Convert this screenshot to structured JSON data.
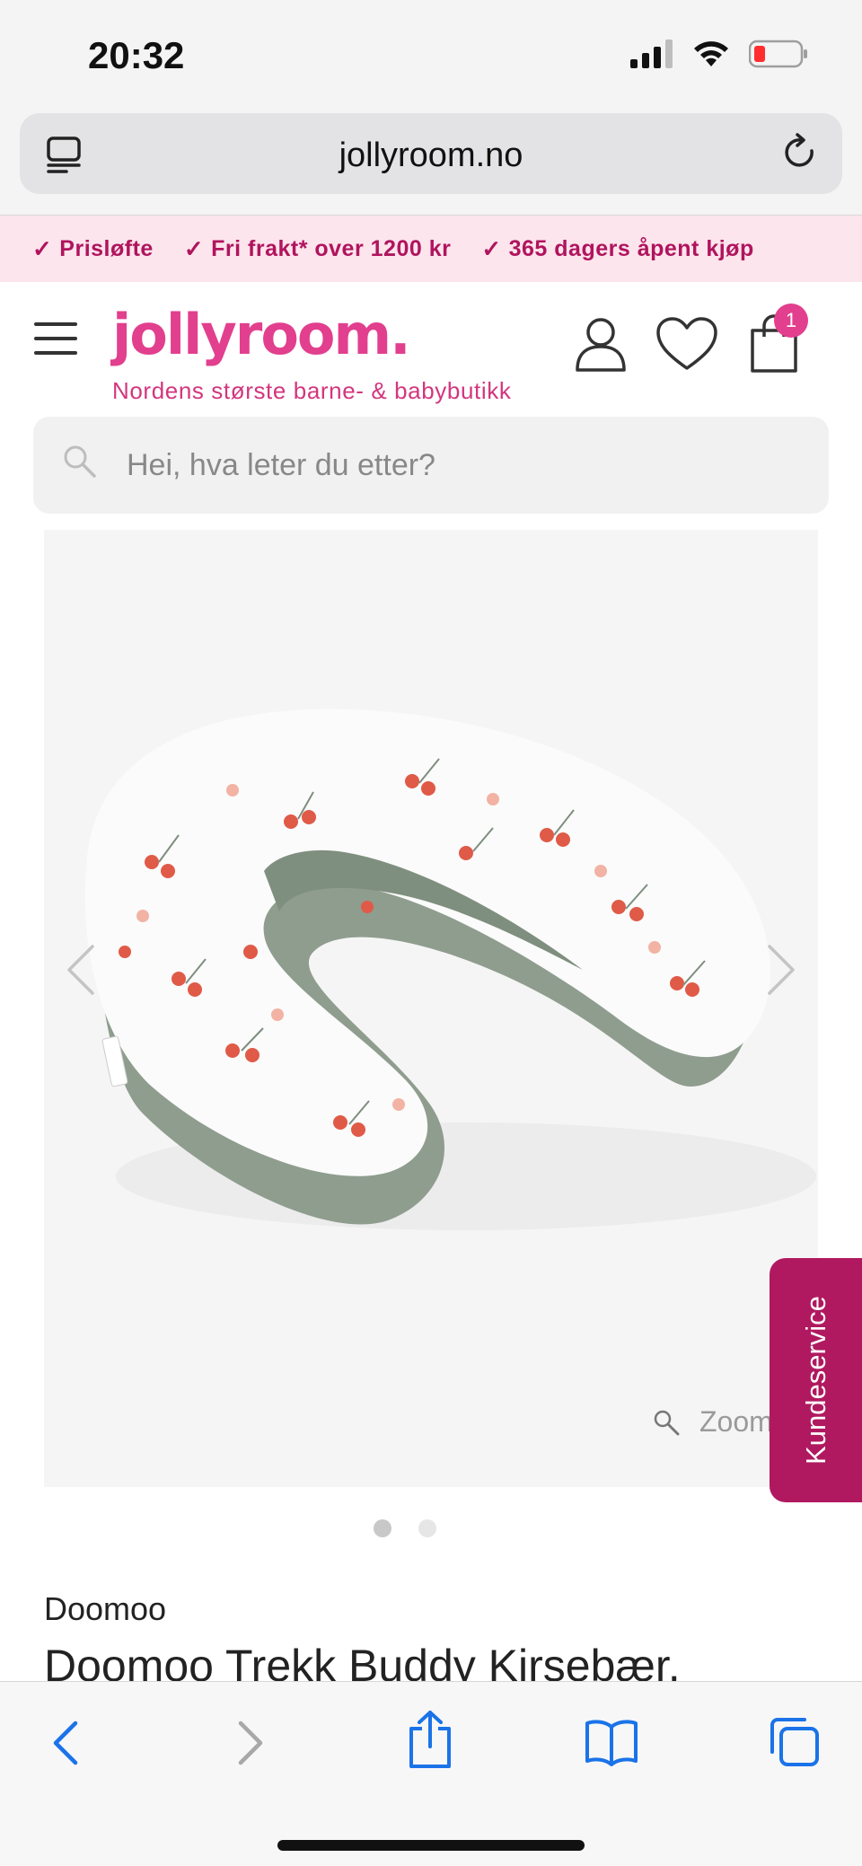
{
  "status": {
    "time": "20:32",
    "icons": [
      "cellular-signal-icon",
      "wifi-icon",
      "battery-low-icon"
    ]
  },
  "browser": {
    "url": "jollyroom.no",
    "tabs_icon": "tabs-icon",
    "reload_icon": "reload-icon"
  },
  "promo": {
    "items": [
      "Prisløfte",
      "Fri frakt* over 1200 kr",
      "365 dagers åpent kjøp"
    ],
    "accent": "#b0145e",
    "background": "#fce5ec"
  },
  "header": {
    "logo": "jollyroom.",
    "tagline": "Nordens største barne- & babybutikk",
    "cart_count": "1",
    "brand_color": "#e23f8e"
  },
  "search": {
    "placeholder": "Hei, hva leter du etter?",
    "value": ""
  },
  "gallery": {
    "zoom_label": "Zoom",
    "slide_count": 2,
    "active_slide": 1
  },
  "service": {
    "label": "Kundeservice",
    "color": "#b0195f"
  },
  "product": {
    "brand": "Doomoo",
    "title": "Doomoo Trekk Buddy Kirsebær,"
  },
  "toolbar": {
    "icons": [
      "back-icon",
      "forward-icon",
      "share-icon",
      "bookmarks-icon",
      "tabs-overview-icon"
    ],
    "accent": "#1a73e8"
  }
}
